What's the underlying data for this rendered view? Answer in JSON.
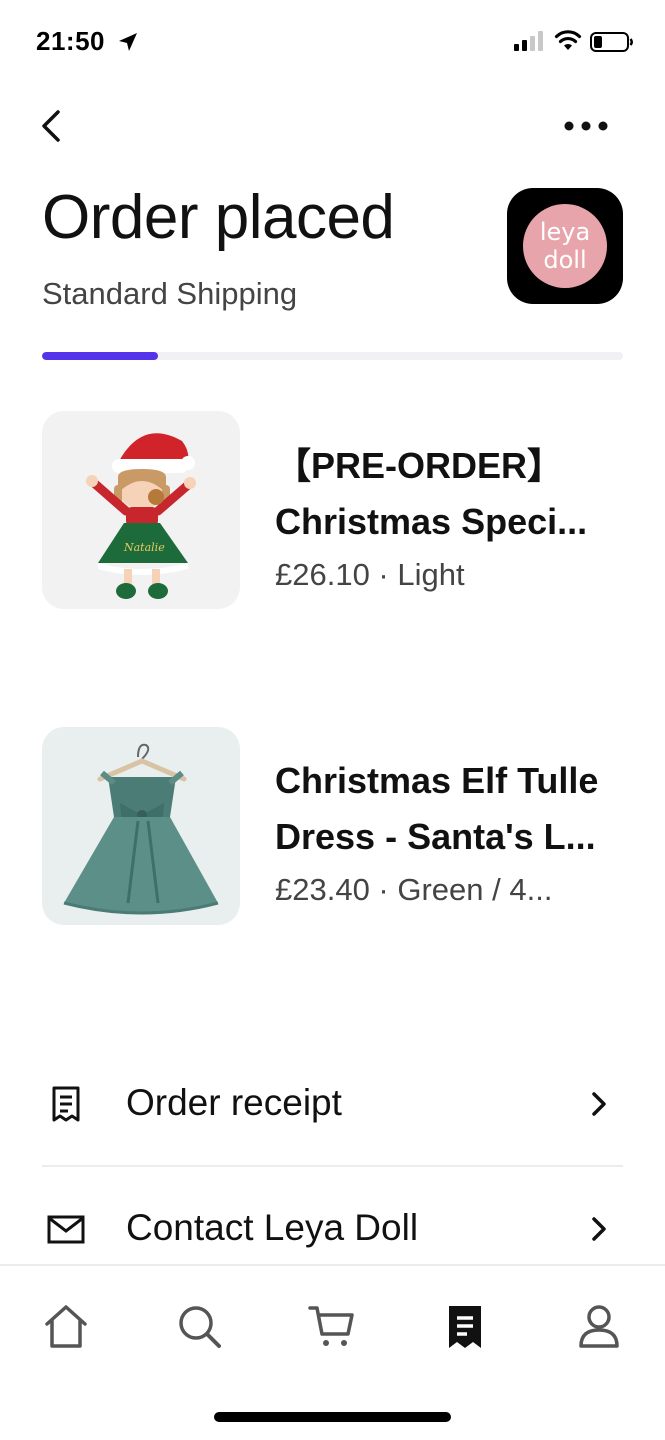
{
  "status_bar": {
    "time": "21:50"
  },
  "header": {
    "title": "Order placed",
    "subtitle": "Standard Shipping",
    "shop_logo_line1": "leya",
    "shop_logo_line2": "doll",
    "progress_fraction": 0.2
  },
  "items": [
    {
      "name": "【PRE-ORDER】",
      "name_line2": "Christmas Speci...",
      "meta": "£26.10 · Light"
    },
    {
      "name": "Christmas Elf Tulle",
      "name_line2": "Dress - Santa's L...",
      "meta": "£23.40 · Green / 4..."
    }
  ],
  "actions": {
    "receipt_label": "Order receipt",
    "contact_label": "Contact Leya Doll"
  },
  "tabs": [
    "home",
    "search",
    "cart",
    "orders",
    "account"
  ],
  "colors": {
    "accent": "#5433eb",
    "logo_pink": "#e7a5ab",
    "text_primary": "#111111",
    "text_secondary": "#444444"
  }
}
